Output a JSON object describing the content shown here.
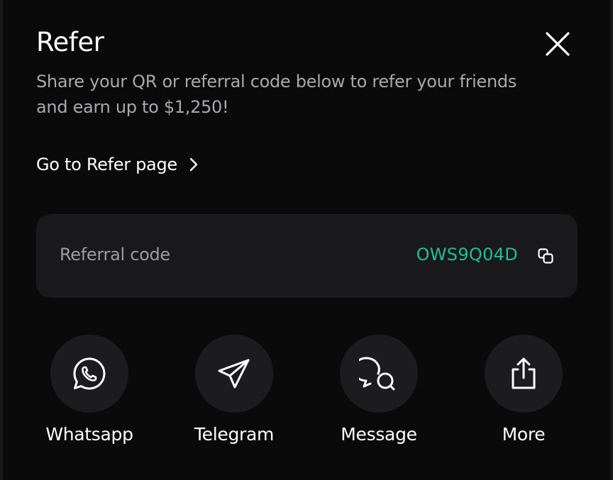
{
  "header": {
    "title": "Refer",
    "subtitle": "Share your QR or referral code below to refer your friends and earn up to $1,250!"
  },
  "refer_link": {
    "label": "Go to Refer page"
  },
  "referral": {
    "label": "Referral code",
    "code": "OWS9Q04D",
    "accent_color": "#1fbf95"
  },
  "share_options": [
    {
      "label": "Whatsapp",
      "icon": "whatsapp-icon"
    },
    {
      "label": "Telegram",
      "icon": "telegram-icon"
    },
    {
      "label": "Message",
      "icon": "message-icon"
    },
    {
      "label": "More",
      "icon": "share-icon"
    }
  ],
  "icons": {
    "close": "close-icon",
    "chevron": "chevron-right-icon",
    "copy": "copy-icon"
  }
}
